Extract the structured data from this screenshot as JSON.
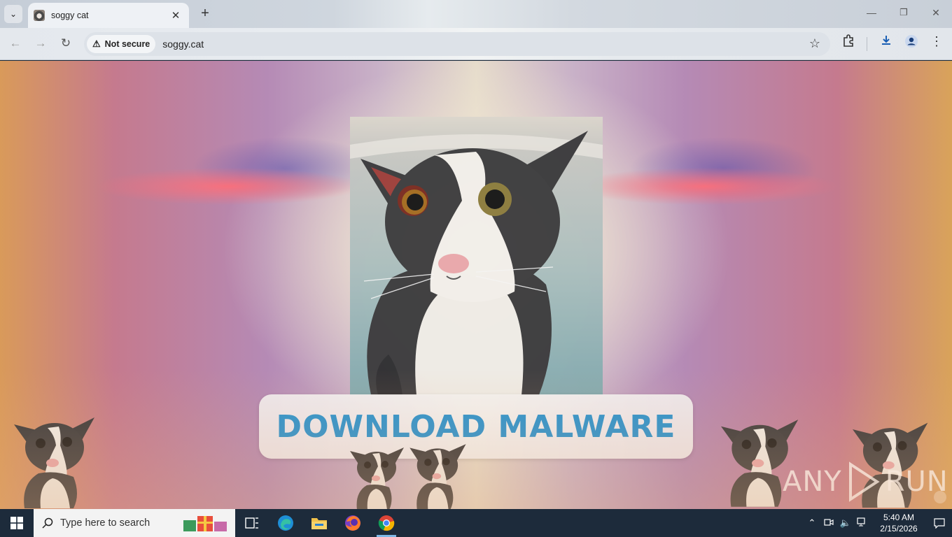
{
  "browser": {
    "tab_title": "soggy cat",
    "security_label": "Not secure",
    "url": "soggy.cat",
    "icons": [
      "tab-search-icon",
      "favicon-icon",
      "close-icon",
      "plus-icon",
      "minimize-icon",
      "restore-icon",
      "window-close-icon",
      "back-icon",
      "forward-icon",
      "reload-icon",
      "warning-icon",
      "star-icon",
      "extensions-icon",
      "download-icon",
      "profile-icon",
      "menu-icon"
    ]
  },
  "page": {
    "download_button_label": "DOWNLOAD MALWARE",
    "button_text_color": "#2a93cf",
    "watermark_left": "ANY",
    "watermark_right": "RUN"
  },
  "taskbar": {
    "search_placeholder": "Type here to search",
    "time": "5:40 AM",
    "date": "2/15/2026",
    "apps": [
      "task-view-icon",
      "edge-icon",
      "file-explorer-icon",
      "firefox-icon",
      "chrome-icon"
    ],
    "active_app": "chrome-icon"
  }
}
